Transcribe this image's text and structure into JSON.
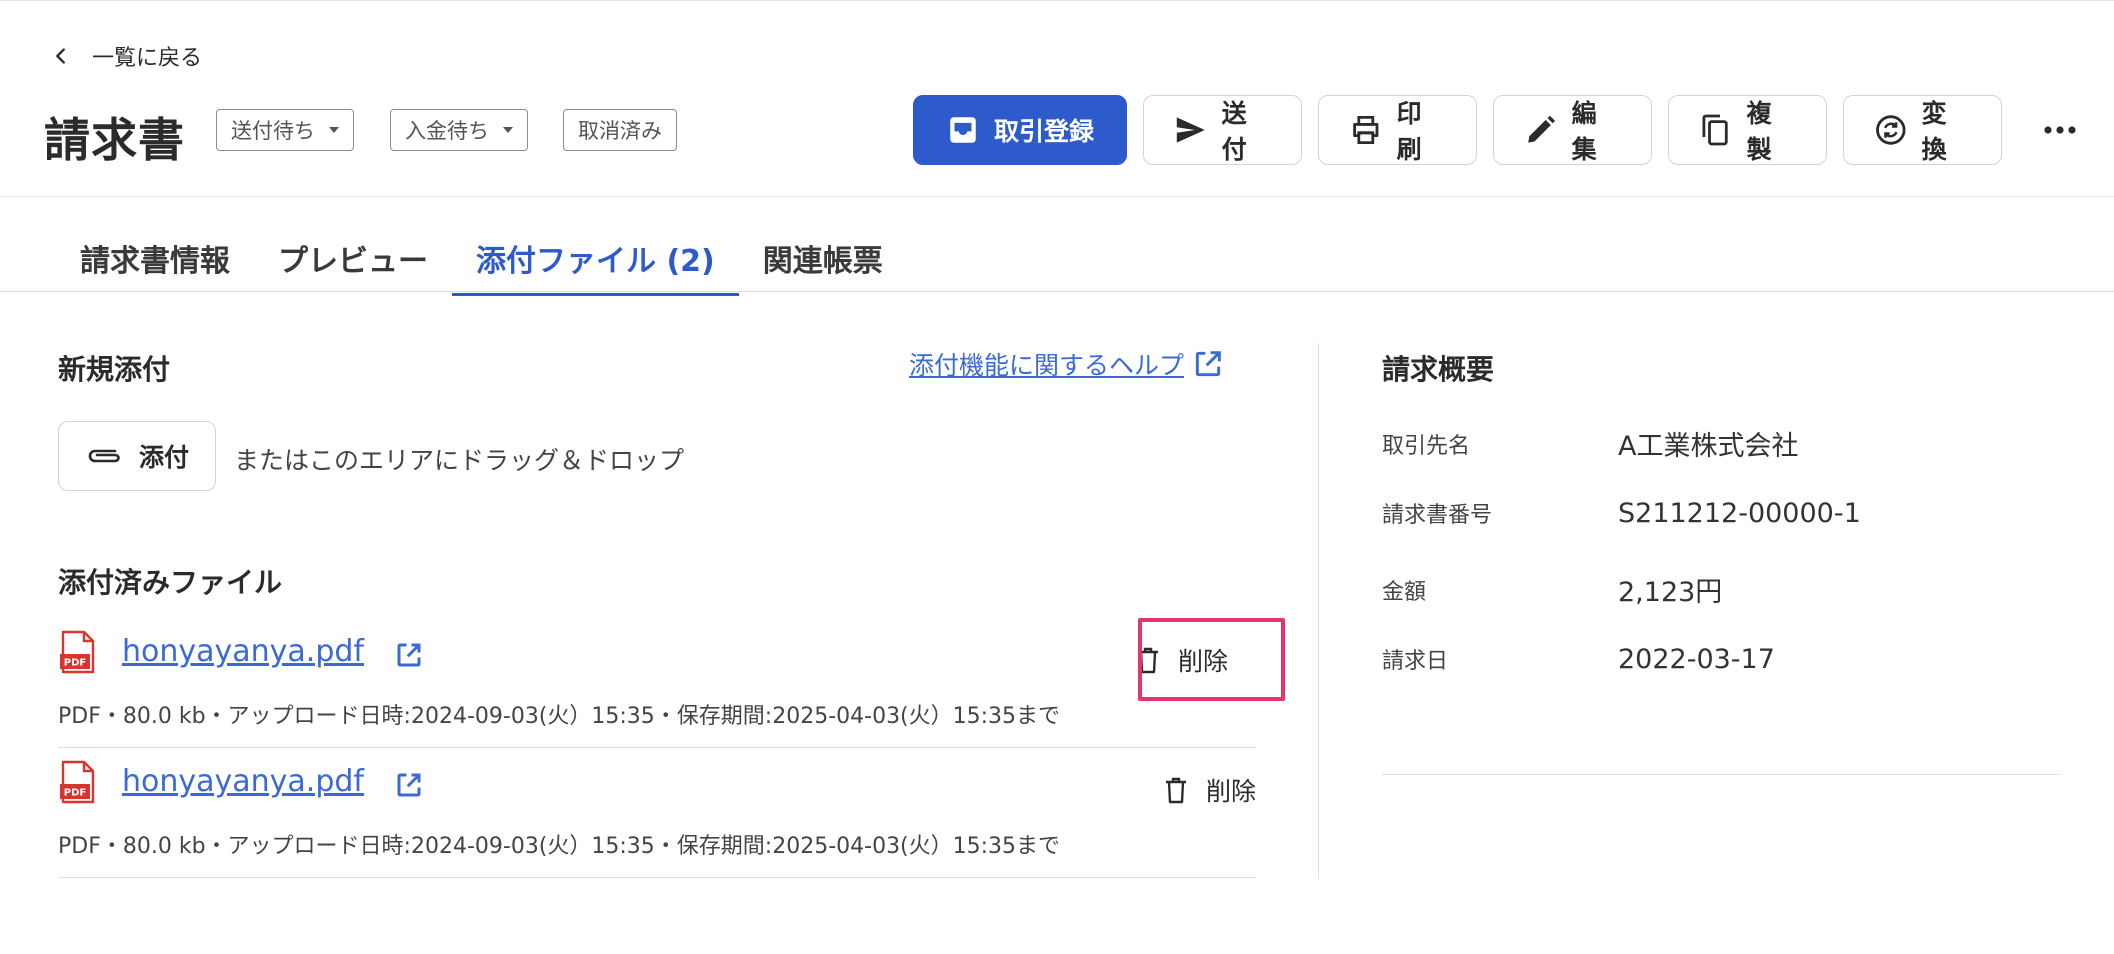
{
  "back": {
    "label": "一覧に戻る"
  },
  "header": {
    "title": "請求書",
    "statuses": [
      {
        "label": "送付待ち",
        "dropdown": true
      },
      {
        "label": "入金待ち",
        "dropdown": true
      },
      {
        "label": "取消済み",
        "dropdown": false
      }
    ],
    "actions": [
      {
        "label": "取引登録",
        "icon": "inbox-icon",
        "primary": true
      },
      {
        "label": "送付",
        "icon": "send-icon"
      },
      {
        "label": "印刷",
        "icon": "printer-icon"
      },
      {
        "label": "編集",
        "icon": "pencil-icon"
      },
      {
        "label": "複製",
        "icon": "copy-icon"
      },
      {
        "label": "変換",
        "icon": "convert-icon"
      }
    ],
    "more_icon": "more-horizontal-icon"
  },
  "tabs": [
    {
      "label": "請求書情報",
      "active": false
    },
    {
      "label": "プレビュー",
      "active": false
    },
    {
      "label": "添付ファイル (2)",
      "active": true
    },
    {
      "label": "関連帳票",
      "active": false
    }
  ],
  "attach": {
    "new_title": "新規添付",
    "help_link": "添付機能に関するヘルプ",
    "attach_button": "添付",
    "drop_hint": "またはこのエリアにドラッグ＆ドロップ",
    "attached_title": "添付済みファイル",
    "delete_label": "削除",
    "files": [
      {
        "name": "honyayanya.pdf",
        "meta": "PDF・80.0 kb・アップロード日時:2024-09-03(火）15:35・保存期間:2025-04-03(火）15:35まで",
        "highlighted": true
      },
      {
        "name": "honyayanya.pdf",
        "meta": "PDF・80.0 kb・アップロード日時:2024-09-03(火）15:35・保存期間:2025-04-03(火）15:35まで",
        "highlighted": false
      }
    ]
  },
  "summary": {
    "title": "請求概要",
    "rows": [
      {
        "key": "取引先名",
        "value": "A工業株式会社"
      },
      {
        "key": "請求書番号",
        "value": "S211212-00000-1"
      },
      {
        "key": "金額",
        "value": "2,123円"
      },
      {
        "key": "請求日",
        "value": "2022-03-17"
      }
    ]
  },
  "colors": {
    "primary": "#2e5bcc",
    "link": "#3b6ad4",
    "highlight": "#e23670",
    "pdf_red": "#d8352f"
  }
}
